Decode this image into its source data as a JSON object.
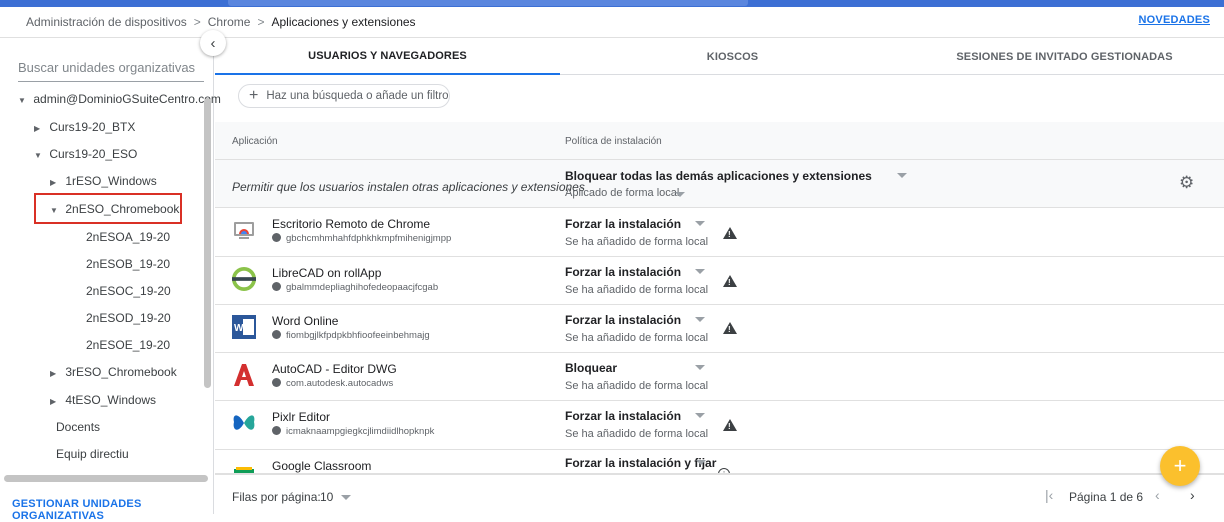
{
  "breadcrumb": {
    "items": [
      "Administración de dispositivos",
      "Chrome",
      "Aplicaciones y extensiones"
    ],
    "separator": ">"
  },
  "header": {
    "novedades": "NOVEDADES"
  },
  "sidebar": {
    "search_placeholder": "Buscar unidades organizativas",
    "collapse_icon": "chevron-left-icon",
    "tree": [
      {
        "label": "admin@DominioGSuiteCentro.com",
        "expanded": true
      },
      {
        "label": "Curs19-20_BTX",
        "expanded": false
      },
      {
        "label": "Curs19-20_ESO",
        "expanded": true
      },
      {
        "label": "1rESO_Windows",
        "expanded": false
      },
      {
        "label": "2nESO_Chromebook",
        "expanded": true,
        "selected": true
      },
      {
        "label": "2nESOA_19-20"
      },
      {
        "label": "2nESOB_19-20"
      },
      {
        "label": "2nESOC_19-20"
      },
      {
        "label": "2nESOD_19-20"
      },
      {
        "label": "2nESOE_19-20"
      },
      {
        "label": "3rESO_Chromebook",
        "expanded": false
      },
      {
        "label": "4tESO_Windows",
        "expanded": false
      },
      {
        "label": "Docents"
      },
      {
        "label": "Equip directiu"
      }
    ],
    "manage_link": "GESTIONAR UNIDADES ORGANIZATIVAS"
  },
  "tabs": [
    {
      "label": "USUARIOS Y NAVEGADORES",
      "active": true
    },
    {
      "label": "KIOSCOS",
      "active": false
    },
    {
      "label": "SESIONES DE INVITADO GESTIONADAS",
      "active": false
    }
  ],
  "filter": {
    "placeholder": "Haz una búsqueda o añade un filtro"
  },
  "table": {
    "headers": {
      "app": "Aplicación",
      "policy": "Política de instalación"
    },
    "default_row": {
      "text": "Permitir que los usuarios instalen otras aplicaciones y extensiones",
      "policy": "Bloquear todas las demás aplicaciones y extensiones",
      "sub": "Aplicado de forma local"
    },
    "rows": [
      {
        "name": "Escritorio Remoto de Chrome",
        "id": "gbchcmhmhahfdphkhkmpfmihenigjmpp",
        "policy": "Forzar la instalación",
        "sub": "Se ha añadido de forma local",
        "icon": "remote-desktop-icon",
        "warning": true
      },
      {
        "name": "LibreCAD on rollApp",
        "id": "gbalmmdepliaghihofedeopaacjfcgab",
        "policy": "Forzar la instalación",
        "sub": "Se ha añadido de forma local",
        "icon": "librecad-icon",
        "warning": true
      },
      {
        "name": "Word Online",
        "id": "fiombgjlkfpdpkbhfioofeeinbehmajg",
        "policy": "Forzar la instalación",
        "sub": "Se ha añadido de forma local",
        "icon": "word-icon",
        "warning": true
      },
      {
        "name": "AutoCAD - Editor DWG",
        "id": "com.autodesk.autocadws",
        "policy": "Bloquear",
        "sub": "Se ha añadido de forma local",
        "icon": "autocad-icon",
        "warning": false
      },
      {
        "name": "Pixlr Editor",
        "id": "icmaknaampgiegkcjlimdiidlhopknpk",
        "policy": "Forzar la instalación",
        "sub": "Se ha añadido de forma local",
        "icon": "pixlr-icon",
        "warning": true
      },
      {
        "name": "Google Classroom",
        "id": "",
        "policy": "Forzar la instalación y fijar",
        "sub": "",
        "icon": "classroom-icon",
        "warning": false,
        "info": true
      }
    ]
  },
  "footer": {
    "rows_per_page_label": "Filas por página:",
    "rows_per_page_value": "10",
    "page_info": "Página 1 de 6"
  },
  "fab": {
    "icon": "plus-icon",
    "label": "+"
  },
  "colors": {
    "accent": "#1a73e8",
    "topbar": "#3c6fd4",
    "fab": "#fbc02d",
    "highlight": "#d93025"
  }
}
